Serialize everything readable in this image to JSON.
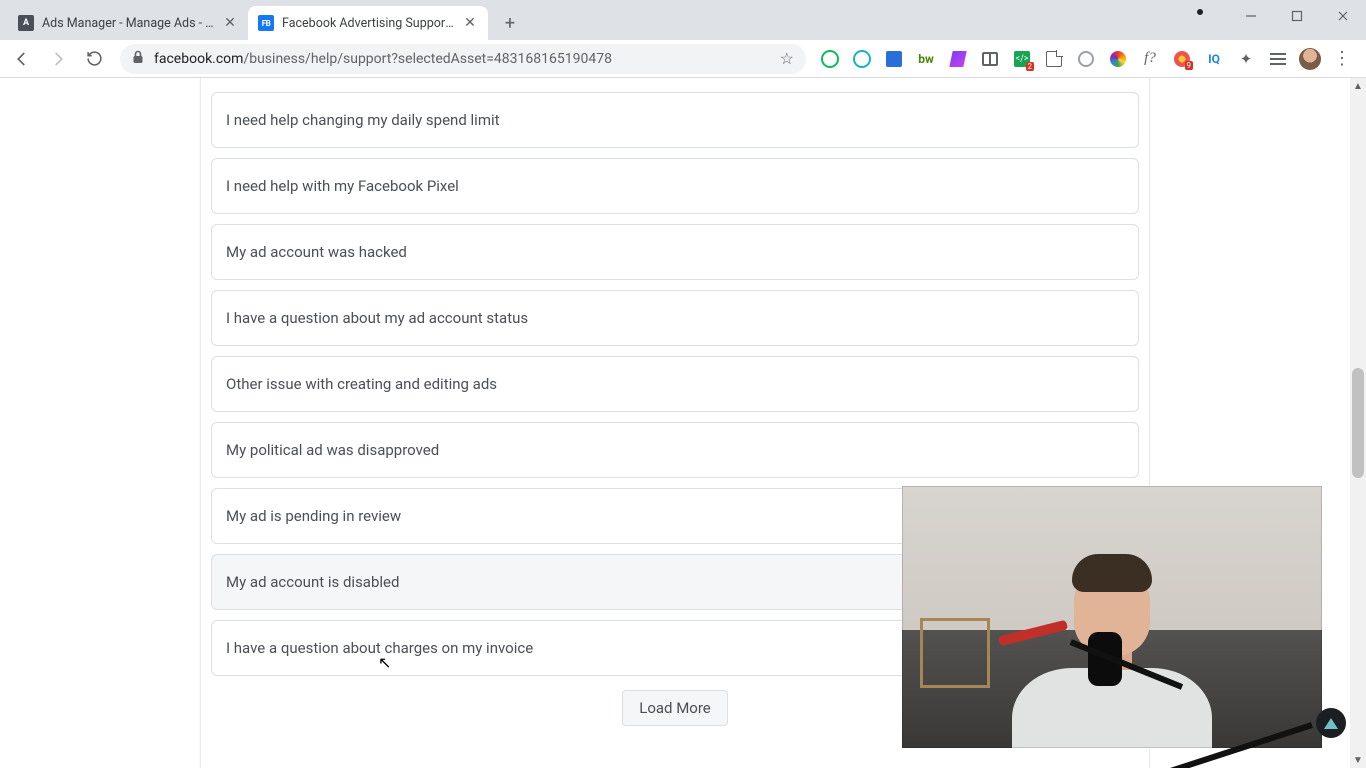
{
  "tabs": [
    {
      "title": "Ads Manager - Manage Ads - Ca",
      "favicon_label": "A"
    },
    {
      "title": "Facebook Advertising Support | F",
      "favicon_label": "FB"
    }
  ],
  "url": {
    "host": "facebook.com",
    "path": "/business/help/support?selectedAsset=483168165190478"
  },
  "issues": [
    "I need help changing my daily spend limit",
    "I need help with my Facebook Pixel",
    "My ad account was hacked",
    "I have a question about my ad account status",
    "Other issue with creating and editing ads",
    "My political ad was disapproved",
    "My ad is pending in review",
    "My ad account is disabled",
    "I have a question about charges on my invoice"
  ],
  "hover_index": 7,
  "load_more_label": "Load More",
  "ext_badges": {
    "code": "2",
    "burst": "9"
  }
}
